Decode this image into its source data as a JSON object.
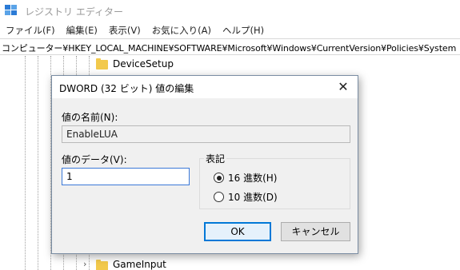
{
  "window": {
    "title": "レジストリ エディター"
  },
  "menu": [
    "ファイル(F)",
    "編集(E)",
    "表示(V)",
    "お気に入り(A)",
    "ヘルプ(H)"
  ],
  "address": "コンピューター¥HKEY_LOCAL_MACHINE¥SOFTWARE¥Microsoft¥Windows¥CurrentVersion¥Policies¥System",
  "tree": {
    "items": [
      {
        "label": "DeviceSetup"
      },
      {
        "label": "GameInput"
      }
    ]
  },
  "dialog": {
    "title": "DWORD (32 ビット) 値の編集",
    "name_label": "値の名前(N):",
    "name_value": "EnableLUA",
    "data_label": "値のデータ(V):",
    "data_value": "1",
    "base_label": "表記",
    "radio_hex": "16 進数(H)",
    "radio_dec": "10 進数(D)",
    "selected_base": "hex",
    "ok_label": "OK",
    "cancel_label": "キャンセル"
  },
  "colors": {
    "accent": "#0078d7",
    "folder": "#f2c94c",
    "dialog_bg": "#f0f0f0"
  }
}
